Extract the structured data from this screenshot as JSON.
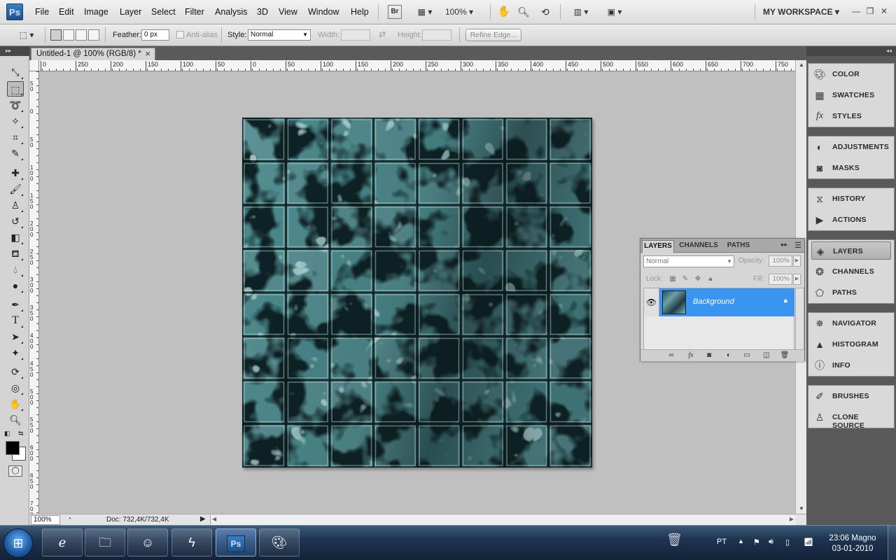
{
  "app": {
    "logo": "Ps",
    "menu": [
      "File",
      "Edit",
      "Image",
      "Layer",
      "Select",
      "Filter",
      "Analysis",
      "3D",
      "View",
      "Window",
      "Help"
    ],
    "bridge_button": "Br",
    "zoom": "100%",
    "workspace": "MY WORKSPACE"
  },
  "options": {
    "feather_label": "Feather:",
    "feather_value": "0 px",
    "antialias_label": "Anti-alias",
    "style_label": "Style:",
    "style_value": "Normal",
    "width_label": "Width:",
    "height_label": "Height:",
    "refine_edge": "Refine Edge..."
  },
  "document": {
    "tab_title": "Untitled-1 @ 100% (RGB/8) *",
    "close": "×",
    "status_zoom": "100%",
    "status_doc": "Doc: 732,4K/732,4K"
  },
  "ruler": {
    "h_labels": [
      "0",
      "250",
      "200",
      "150",
      "100",
      "50",
      "0",
      "50",
      "100",
      "150",
      "200",
      "250",
      "300",
      "350",
      "400",
      "450",
      "500",
      "550",
      "600",
      "650",
      "700",
      "750"
    ],
    "v_labels": [
      "50",
      "0",
      "50",
      "100",
      "150",
      "200",
      "250",
      "300",
      "350",
      "400",
      "450",
      "500",
      "550",
      "600",
      "650",
      "700"
    ]
  },
  "tools": [
    "move",
    "rectangular-marquee",
    "lasso",
    "magic-wand",
    "crop",
    "eyedropper",
    "spot-healing",
    "brush",
    "clone-stamp",
    "history-brush",
    "eraser",
    "paint-bucket",
    "blur",
    "dodge",
    "pen",
    "type",
    "path-selection",
    "custom-shape",
    "3d-rotate",
    "3d-orbit",
    "hand",
    "zoom"
  ],
  "dock": {
    "group1": [
      "COLOR",
      "SWATCHES",
      "STYLES"
    ],
    "group2": [
      "ADJUSTMENTS",
      "MASKS"
    ],
    "group3": [
      "HISTORY",
      "ACTIONS"
    ],
    "group4": [
      "LAYERS",
      "CHANNELS",
      "PATHS"
    ],
    "group5": [
      "NAVIGATOR",
      "HISTOGRAM",
      "INFO"
    ],
    "group6": [
      "BRUSHES",
      "CLONE SOURCE"
    ]
  },
  "layers_panel": {
    "tabs": [
      "LAYERS",
      "CHANNELS",
      "PATHS"
    ],
    "blend_mode": "Normal",
    "opacity_label": "Opacity:",
    "opacity_value": "100%",
    "lock_label": "Lock:",
    "fill_label": "Fill:",
    "fill_value": "100%",
    "layer_name": "Background"
  },
  "taskbar": {
    "language": "PT",
    "time": "23:06 Magno",
    "date": "03-01-2010",
    "ps_label": "Ps"
  },
  "colors": {
    "texture_base": "#4a8a8e",
    "texture_dark": "#0c1a1c",
    "texture_light": "#bfe3e3",
    "layer_highlight": "#3a95f0",
    "canvas_bg": "#c0c0c0"
  }
}
